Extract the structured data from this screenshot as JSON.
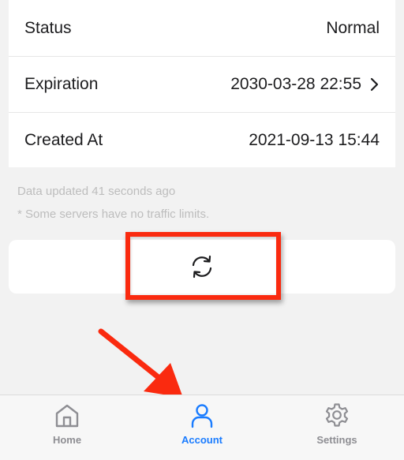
{
  "info_rows": [
    {
      "label": "Status",
      "value": "Normal"
    },
    {
      "label": "Expiration",
      "value": "2030-03-28 22:55"
    },
    {
      "label": "Created At",
      "value": "2021-09-13 15:44"
    }
  ],
  "notes": {
    "updated": "Data updated 41 seconds ago",
    "traffic": "* Some servers have no traffic limits."
  },
  "refresh": {
    "icon": "refresh-icon"
  },
  "tabs": [
    {
      "label": "Home",
      "icon": "home-icon",
      "active": false
    },
    {
      "label": "Account",
      "icon": "person-icon",
      "active": true
    },
    {
      "label": "Settings",
      "icon": "gear-icon",
      "active": false
    }
  ],
  "colors": {
    "accent": "#1a7cff",
    "inactive_tab": "#8e8e93",
    "annotation_red": "#fa2a0f",
    "note_text": "#bdbdbd",
    "background": "#f2f2f2"
  }
}
